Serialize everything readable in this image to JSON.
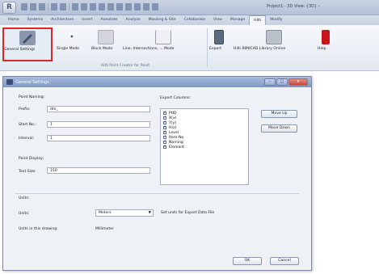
{
  "window": {
    "title": "Project1 - 3D View: {3D} -"
  },
  "tabs": [
    "Home",
    "Systems",
    "Architecture",
    "Insert",
    "Annotate",
    "Analyze",
    "Massing & Site",
    "Collaborate",
    "View",
    "Manage",
    "Hilti",
    "Modify"
  ],
  "active_tab": "Hilti",
  "ribbon": {
    "buttons": [
      {
        "label": "General Settings",
        "icon": "wrench-icon"
      },
      {
        "label": "Single Mode",
        "icon": "point-icon"
      },
      {
        "label": "Block Mode",
        "icon": "block-icon"
      },
      {
        "label": "Line, Intersections, ... Mode",
        "icon": "line-intersection-icon"
      },
      {
        "label": "Export",
        "icon": "export-icon"
      },
      {
        "label": "Hilti BIM/CAD Library Online",
        "icon": "library-icon"
      },
      {
        "label": "Help",
        "icon": "help-icon"
      }
    ],
    "panel_label": "Hilti Point Creator for Revit"
  },
  "dialog": {
    "title": "General Settings",
    "controls": {
      "minimize": "–",
      "maximize": "□",
      "close": "x"
    },
    "point_naming": {
      "label": "Point Naming:",
      "prefix_label": "Prefix:",
      "prefix_value": "dm_",
      "start_no_label": "Start No.:",
      "start_no_value": "1",
      "interval_label": "Interval:",
      "interval_value": "1"
    },
    "point_display": {
      "label": "Point Display:",
      "text_size_label": "Text Size:",
      "text_size_value": "150"
    },
    "export_columns": {
      "label": "Export Columns:",
      "items": [
        "PtID",
        "X(x)",
        "Y(y)",
        "H(z)",
        "Level",
        "Item-No",
        "Naming",
        "Element"
      ],
      "move_up": "Move Up",
      "move_down": "Move Down"
    },
    "units": {
      "label": "Units:",
      "units_label": "Units:",
      "units_value": "Meters",
      "export_note": "Set units for Export Data File",
      "drawing_label": "Units in this drawing:",
      "drawing_value": "Millimeter"
    },
    "ok": "OK",
    "cancel": "Cancel"
  }
}
